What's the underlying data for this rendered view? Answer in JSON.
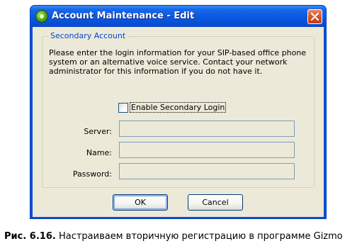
{
  "window": {
    "title": "Account Maintenance - Edit"
  },
  "group": {
    "legend": "Secondary Account",
    "description_lines": [
      "Please enter the login information for your SIP-based office phone",
      "system or an alternative voice service.  Contact your network",
      "administrator for this information if you do not have it."
    ],
    "checkbox_label": "Enable Secondary Login",
    "checkbox_checked": false
  },
  "fields": {
    "server_label": "Server:",
    "server_value": "",
    "name_label": "Name:",
    "name_value": "",
    "password_label": "Password:",
    "password_value": ""
  },
  "buttons": {
    "ok": "OK",
    "cancel": "Cancel"
  },
  "caption": {
    "figure": "Рис. 6.16.",
    "text": " Настраиваем вторичную регистрацию в программе Gizmo"
  },
  "colors": {
    "titlebar": "#0a58e2",
    "client_bg": "#ece9d8",
    "legend_text": "#0046d5",
    "close_button": "#d8542e"
  },
  "icons": {
    "app": "gizmo-app-icon",
    "close": "close-icon"
  }
}
